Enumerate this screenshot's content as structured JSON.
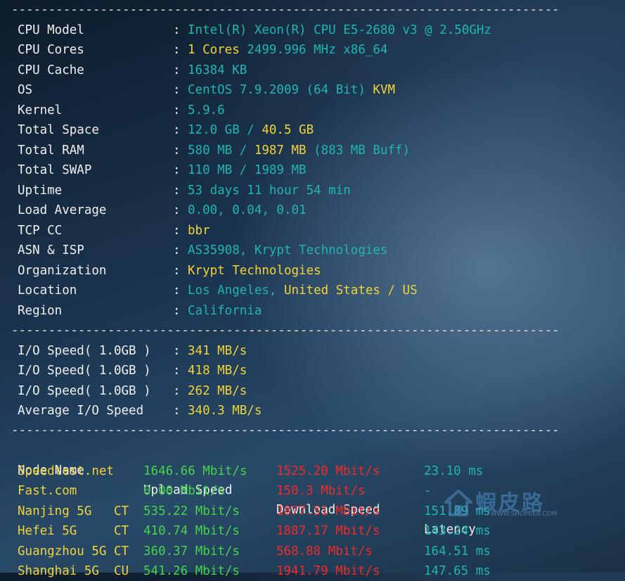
{
  "separator": "--------------------------------------------------------------------------",
  "colon": ":",
  "system_info": [
    {
      "label": "CPU Model",
      "parts": [
        {
          "t": "Intel(R) Xeon(R) CPU E5-2680 v3 @ 2.50GHz",
          "c": "cy"
        }
      ]
    },
    {
      "label": "CPU Cores",
      "parts": [
        {
          "t": "1 Cores",
          "c": "yl"
        },
        {
          "t": " 2499.996 MHz x86_64",
          "c": "cy"
        }
      ]
    },
    {
      "label": "CPU Cache",
      "parts": [
        {
          "t": "16384 KB",
          "c": "cy"
        }
      ]
    },
    {
      "label": "OS",
      "parts": [
        {
          "t": "CentOS 7.9.2009 (64 Bit)",
          "c": "cy"
        },
        {
          "t": " KVM",
          "c": "yl"
        }
      ]
    },
    {
      "label": "Kernel",
      "parts": [
        {
          "t": "5.9.6",
          "c": "cy"
        }
      ]
    },
    {
      "label": "Total Space",
      "parts": [
        {
          "t": "12.0 GB / ",
          "c": "cy"
        },
        {
          "t": "40.5 GB",
          "c": "yl"
        }
      ]
    },
    {
      "label": "Total RAM",
      "parts": [
        {
          "t": "580 MB / ",
          "c": "cy"
        },
        {
          "t": "1987 MB",
          "c": "yl"
        },
        {
          "t": " (883 MB Buff)",
          "c": "cy"
        }
      ]
    },
    {
      "label": "Total SWAP",
      "parts": [
        {
          "t": "110 MB / 1989 MB",
          "c": "cy"
        }
      ]
    },
    {
      "label": "Uptime",
      "parts": [
        {
          "t": "53 days 11 hour 54 min",
          "c": "cy"
        }
      ]
    },
    {
      "label": "Load Average",
      "parts": [
        {
          "t": "0.00, 0.04, 0.01",
          "c": "cy"
        }
      ]
    },
    {
      "label": "TCP CC",
      "parts": [
        {
          "t": "bbr",
          "c": "yl"
        }
      ]
    },
    {
      "label": "ASN & ISP",
      "parts": [
        {
          "t": "AS35908, Krypt Technologies",
          "c": "cy"
        }
      ]
    },
    {
      "label": "Organization",
      "parts": [
        {
          "t": "Krypt Technologies",
          "c": "yl"
        }
      ]
    },
    {
      "label": "Location",
      "parts": [
        {
          "t": "Los Angeles, ",
          "c": "cy"
        },
        {
          "t": "United States / US",
          "c": "yl"
        }
      ]
    },
    {
      "label": "Region",
      "parts": [
        {
          "t": "California",
          "c": "cy"
        }
      ]
    }
  ],
  "io_info": [
    {
      "label": "I/O Speed( 1.0GB )",
      "value": "341 MB/s"
    },
    {
      "label": "I/O Speed( 1.0GB )",
      "value": "418 MB/s"
    },
    {
      "label": "I/O Speed( 1.0GB )",
      "value": "262 MB/s"
    },
    {
      "label": "Average I/O Speed",
      "value": "340.3 MB/s"
    }
  ],
  "speed_table": {
    "headers": [
      "Node Name",
      "Upload Speed",
      "Download Speed",
      "Latency"
    ],
    "rows": [
      {
        "node": "Speedtest.net",
        "upload": "1646.66 Mbit/s",
        "download": "1525.20 Mbit/s",
        "latency": "23.10 ms"
      },
      {
        "node": "Fast.com",
        "upload": "0.00 Mbit/s",
        "download": "150.3 Mbit/s",
        "latency": "-"
      },
      {
        "node": "Nanjing 5G   CT",
        "upload": "535.22 Mbit/s",
        "download": "1877.51 Mbit/s",
        "latency": "151.89 ms"
      },
      {
        "node": "Hefei 5G     CT",
        "upload": "410.74 Mbit/s",
        "download": "1887.17 Mbit/s",
        "latency": "143.24 ms"
      },
      {
        "node": "Guangzhou 5G CT",
        "upload": "360.37 Mbit/s",
        "download": "568.88 Mbit/s",
        "latency": "164.51 ms"
      },
      {
        "node": "Shanghai 5G  CU",
        "upload": "541.26 Mbit/s",
        "download": "1941.79 Mbit/s",
        "latency": "147.65 ms"
      }
    ]
  },
  "watermark": {
    "text": "蝦皮路",
    "subtext": "WWW.SHOPEE8.COM"
  },
  "colors": {
    "cyan": "#1fb5b0",
    "yellow": "#f2d33a",
    "green": "#45d44a",
    "red": "#f02a2a",
    "white": "#f0f0f0"
  }
}
